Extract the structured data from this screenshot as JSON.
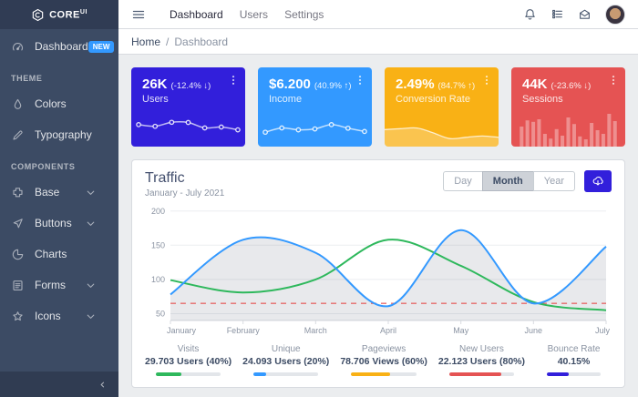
{
  "colors": {
    "primary": "#321fdb",
    "info": "#3399ff",
    "warning": "#f9b115",
    "danger": "#e55353",
    "success": "#2eb85c",
    "sidebar": "#3c4b64",
    "badge_new_bg": "#3399ff"
  },
  "sidebar": {
    "brand": {
      "text": "CORE",
      "sup": "UI"
    },
    "nav": [
      {
        "label": "Dashboard",
        "icon": "speedometer-icon",
        "badge": "NEW"
      },
      {
        "type": "title",
        "label": "THEME"
      },
      {
        "label": "Colors",
        "icon": "drop-icon"
      },
      {
        "label": "Typography",
        "icon": "pencil-icon"
      },
      {
        "type": "title",
        "label": "COMPONENTS"
      },
      {
        "label": "Base",
        "icon": "puzzle-icon",
        "chevron": true
      },
      {
        "label": "Buttons",
        "icon": "cursor-icon",
        "chevron": true
      },
      {
        "label": "Charts",
        "icon": "chart-pie-icon"
      },
      {
        "label": "Forms",
        "icon": "notes-icon",
        "chevron": true
      },
      {
        "label": "Icons",
        "icon": "star-icon",
        "chevron": true
      }
    ],
    "minimizer_icon": "chevron-left-icon"
  },
  "header": {
    "menu_icon": "menu-icon",
    "nav": [
      "Dashboard",
      "Users",
      "Settings"
    ],
    "icons": [
      "bell-icon",
      "list-rich-icon",
      "envelope-open-icon"
    ]
  },
  "breadcrumb": {
    "home": "Home",
    "sep": "/",
    "current": "Dashboard"
  },
  "cards": [
    {
      "value": "26K",
      "delta": "(-12.4% ↓)",
      "label": "Users",
      "color": "#321fdb",
      "spark": {
        "type": "line-markers",
        "values": [
          62,
          55,
          72,
          71,
          48,
          52,
          40
        ]
      }
    },
    {
      "value": "$6.200",
      "delta": "(40.9% ↑)",
      "label": "Income",
      "color": "#3399ff",
      "spark": {
        "type": "line-markers",
        "values": [
          30,
          48,
          40,
          44,
          62,
          47,
          33
        ]
      }
    },
    {
      "value": "2.49%",
      "delta": "(84.7% ↑)",
      "label": "Conversion Rate",
      "color": "#f9b115",
      "spark": {
        "type": "area",
        "values": [
          55,
          58,
          60,
          44,
          26,
          30,
          34,
          30
        ]
      }
    },
    {
      "value": "44K",
      "delta": "(-23.6% ↓)",
      "label": "Sessions",
      "color": "#e55353",
      "spark": {
        "type": "bars",
        "values": [
          55,
          72,
          68,
          75,
          35,
          22,
          48,
          30,
          80,
          62,
          28,
          20,
          65,
          45,
          35,
          90,
          70
        ]
      }
    }
  ],
  "traffic": {
    "title": "Traffic",
    "subtitle": "January - July 2021",
    "range_buttons": [
      "Day",
      "Month",
      "Year"
    ],
    "active_range": "Month",
    "download_icon": "cloud-download-icon"
  },
  "chart_data": {
    "type": "line",
    "title": "Traffic",
    "categories": [
      "January",
      "February",
      "March",
      "April",
      "May",
      "June",
      "July"
    ],
    "series": [
      {
        "name": "traffic-current",
        "color": "#3399ff",
        "fill": true,
        "dashed": false,
        "values": [
          78,
          158,
          139,
          61,
          172,
          65,
          148
        ]
      },
      {
        "name": "traffic-secondary",
        "color": "#2eb85c",
        "fill": false,
        "dashed": false,
        "values": [
          99,
          81,
          100,
          158,
          120,
          67,
          55
        ]
      },
      {
        "name": "baseline",
        "color": "#e55353",
        "fill": false,
        "dashed": true,
        "values": [
          65,
          65,
          65,
          65,
          65,
          65,
          65
        ]
      }
    ],
    "ylim": [
      40,
      205
    ],
    "yticks": [
      50,
      100,
      150,
      200
    ],
    "grid": true,
    "legend": "none"
  },
  "stats": [
    {
      "label": "Visits",
      "value": "29.703 Users (40%)",
      "percent": 40,
      "color": "#2eb85c"
    },
    {
      "label": "Unique",
      "value": "24.093 Users (20%)",
      "percent": 20,
      "color": "#3399ff"
    },
    {
      "label": "Pageviews",
      "value": "78.706 Views (60%)",
      "percent": 60,
      "color": "#f9b115"
    },
    {
      "label": "New Users",
      "value": "22.123 Users (80%)",
      "percent": 80,
      "color": "#e55353"
    },
    {
      "label": "Bounce Rate",
      "value": "40.15%",
      "percent": 40,
      "color": "#321fdb"
    }
  ]
}
